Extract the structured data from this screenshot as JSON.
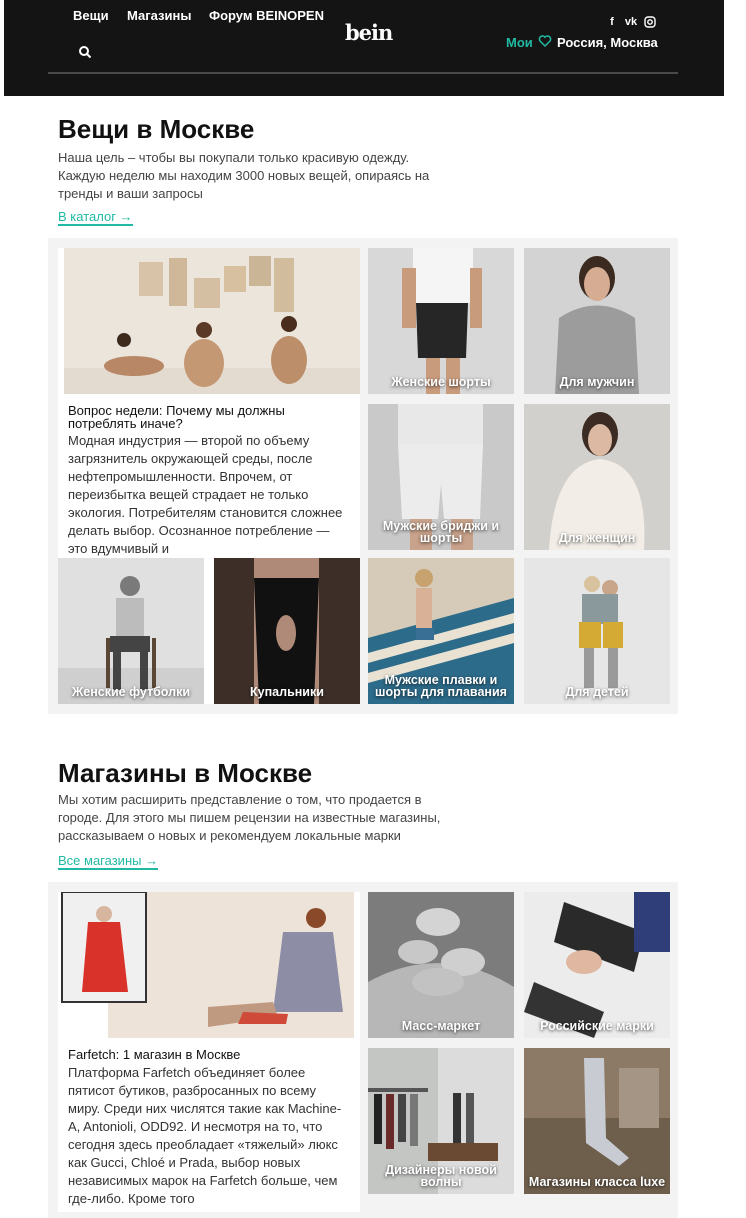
{
  "header": {
    "nav": [
      "Вещи",
      "Магазины",
      "Форум BEINOPEN"
    ],
    "logo": "bein",
    "social": [
      "f",
      "vk",
      "ig"
    ],
    "moi": "Мои",
    "location": "Россия, Москва",
    "accent": "#21b9a3"
  },
  "things": {
    "title": "Вещи в Москве",
    "desc": "Наша цель – чтобы вы покупали только красивую одежду. Каждую неделю мы находим 3000 новых вещей, опираясь на тренды и ваши запросы",
    "link": "В каталог →",
    "feature": {
      "question": "Вопрос недели: Почему мы должны потреблять иначе?",
      "body": "Модная индустрия — второй по объему загрязнитель окружающей среды, после нефтепромышленности. Впрочем, от переизбытка вещей страдает не только экология. Потребителям становится сложнее делать выбор. Осознанное потребление — это вдумчивый и"
    },
    "tiles": [
      "Женские шорты",
      "Для мужчин",
      "Мужские бриджи и шорты",
      "Для женщин",
      "Женские футболки",
      "Купальники",
      "Мужские плавки и шорты для плавания",
      "Для детей"
    ]
  },
  "shops": {
    "title": "Магазины в Москве",
    "desc": "Мы хотим расширить представление о том, что продается в городе. Для этого мы пишем рецензии на известные магазины, рассказываем о новых и рекомендуем локальные марки",
    "link": "Все магазины →",
    "feature": {
      "question": "Farfetch: 1 магазин в Москве",
      "body": "Платформа Farfetch объединяет более пятисот бутиков, разбросанных по всему миру. Среди них числятся такие как Machine-A, Antonioli, ODD92. И несмотря на то, что сегодня здесь преобладает «тяжелый» люкс как Gucci, Chloé и Prada, выбор новых независимых марок на Farfetch больше, чем где-либо. Кроме того"
    },
    "tiles": [
      "Масс-маркет",
      "Российские марки",
      "Дизайнеры новой волны",
      "Магазины класса luxe"
    ]
  }
}
